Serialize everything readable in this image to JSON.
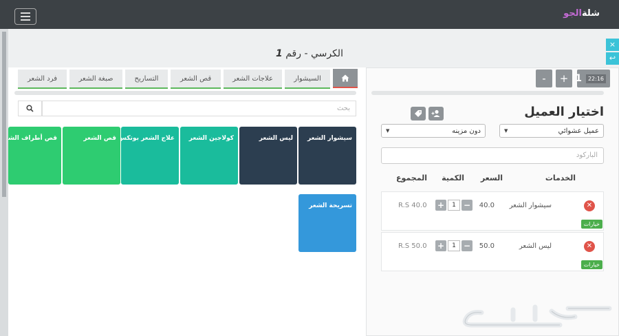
{
  "app": {
    "logo_main": "شلة",
    "logo_accent": "الجو"
  },
  "page": {
    "title_prefix": "الكرسي - رقم ",
    "title_number": "1"
  },
  "side_tools": {
    "close": "×",
    "back": "↩"
  },
  "order": {
    "time": "22:16",
    "number": "1",
    "plus": "+",
    "minus": "-"
  },
  "customer": {
    "title": "اختيار العميل",
    "customer_select": "عميل عشوائي",
    "discount_select": "دون مزينه",
    "barcode_placeholder": "الباركود"
  },
  "services_table": {
    "headers": {
      "service": "الخدمات",
      "price": "السعر",
      "qty": "الكمية",
      "total": "المجموع"
    },
    "rows": [
      {
        "name": "سيشوار الشعر",
        "price": "40.0",
        "qty": "1",
        "total": "R.S 40.0",
        "options": "خيارات"
      },
      {
        "name": "ليس الشعر",
        "price": "50.0",
        "qty": "1",
        "total": "R.S 50.0",
        "options": "خيارات"
      }
    ]
  },
  "categories": [
    "السيشوار",
    "علاجات الشعر",
    "قص الشعر",
    "التساريح",
    "صبغة الشعر",
    "فرد الشعر"
  ],
  "search": {
    "placeholder": "بحث"
  },
  "products": [
    {
      "label": "سيشوار الشعر",
      "color": "#2c3e50"
    },
    {
      "label": "ليس الشعر",
      "color": "#2c3e50"
    },
    {
      "label": "كولاجين الشعر",
      "color": "#1abc9c"
    },
    {
      "label": "علاج الشعر بوتكس",
      "color": "#1abc9c"
    },
    {
      "label": "قص الشعر",
      "color": "#2ecc71"
    },
    {
      "label": "قص أطراف الشعر",
      "color": "#2ecc71"
    },
    {
      "label": "تسريحة الشعر",
      "color": "#3498db"
    }
  ]
}
